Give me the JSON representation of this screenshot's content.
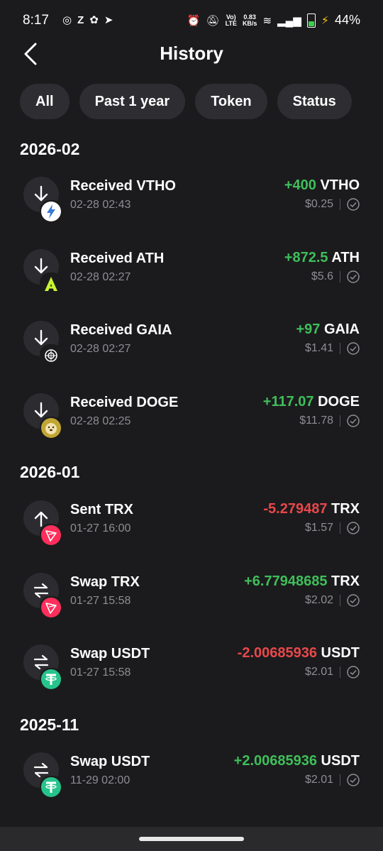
{
  "status_bar": {
    "time": "8:17",
    "speed_top": "0.83",
    "speed_bottom": "KB/s",
    "battery": "44%",
    "volte": "Vo)) LTE"
  },
  "header": {
    "title": "History"
  },
  "filters": [
    "All",
    "Past 1 year",
    "Token",
    "Status"
  ],
  "months": [
    "2026-02",
    "2026-01",
    "2025-11"
  ],
  "transactions": [
    {
      "title": "Received VTHO",
      "date": "02-28 02:43",
      "amount": "+400",
      "symbol": "VTHO",
      "usd": "$0.25",
      "direction": "in",
      "token_color": "#ffffff"
    },
    {
      "title": "Received ATH",
      "date": "02-28 02:27",
      "amount": "+872.5",
      "symbol": "ATH",
      "usd": "$5.6",
      "direction": "in",
      "token_color": "#c6f432"
    },
    {
      "title": "Received GAIA",
      "date": "02-28 02:27",
      "amount": "+97",
      "symbol": "GAIA",
      "usd": "$1.41",
      "direction": "in",
      "token_color": "#ffffff"
    },
    {
      "title": "Received DOGE",
      "date": "02-28 02:25",
      "amount": "+117.07",
      "symbol": "DOGE",
      "usd": "$11.78",
      "direction": "in",
      "token_color": "#c2a633"
    },
    {
      "title": "Sent TRX",
      "date": "01-27 16:00",
      "amount": "-5.279487",
      "symbol": "TRX",
      "usd": "$1.57",
      "direction": "out",
      "token_color": "#ff2e5b"
    },
    {
      "title": "Swap TRX",
      "date": "01-27 15:58",
      "amount": "+6.77948685",
      "symbol": "TRX",
      "usd": "$2.02",
      "direction": "swap",
      "token_color": "#ff2e5b"
    },
    {
      "title": "Swap USDT",
      "date": "01-27 15:58",
      "amount": "-2.00685936",
      "symbol": "USDT",
      "usd": "$2.01",
      "direction": "swap",
      "token_color": "#26c48c"
    },
    {
      "title": "Swap USDT",
      "date": "11-29 02:00",
      "amount": "+2.00685936",
      "symbol": "USDT",
      "usd": "$2.01",
      "direction": "swap",
      "token_color": "#26c48c"
    }
  ],
  "colors": {
    "positive": "#3fbf5a",
    "negative": "#e8484b",
    "background": "#1b1b1d",
    "chip": "#2e2e32"
  }
}
